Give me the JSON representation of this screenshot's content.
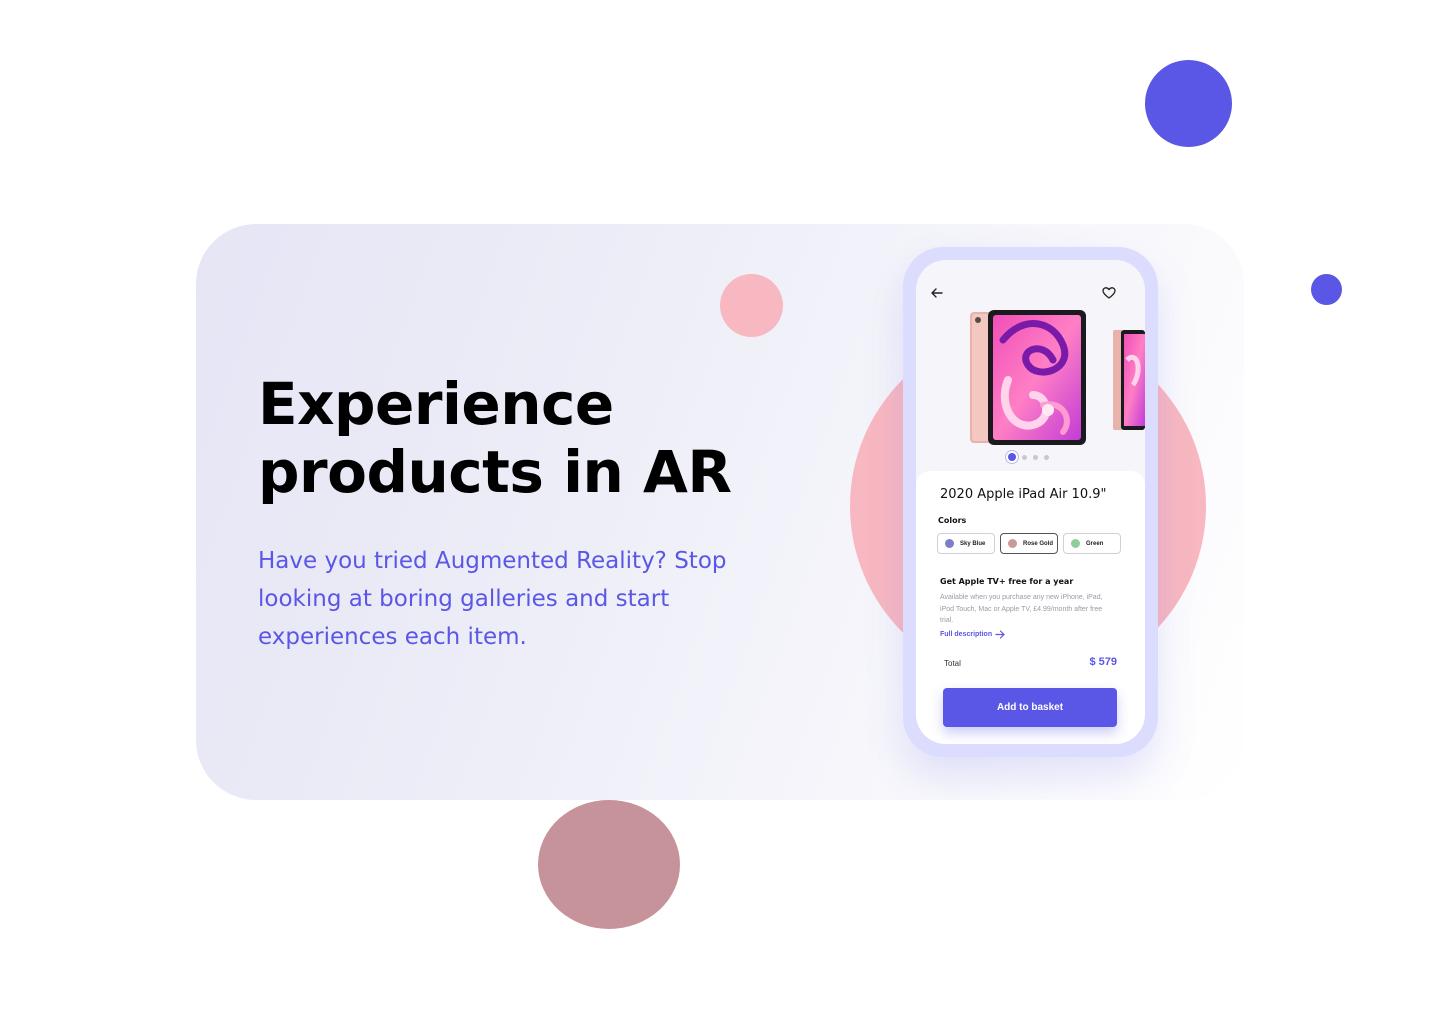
{
  "hero": {
    "headline_line1": "Experience",
    "headline_line2": "products in AR",
    "subtext": "Have you tried Augmented Reality? Stop looking at boring galleries and start experiences each item."
  },
  "app": {
    "product_title": "2020 Apple iPad Air 10.9\"",
    "gallery": {
      "dots": 4,
      "active_index": 0
    },
    "colors_label": "Colors",
    "colors": [
      {
        "label": "Sky Blue",
        "swatch": "#7a7fc6",
        "selected": false
      },
      {
        "label": "Rose Gold",
        "swatch": "#c99a99",
        "selected": true
      },
      {
        "label": "Green",
        "swatch": "#8ecf99",
        "selected": false
      }
    ],
    "promo_title": "Get Apple TV+ free for a year",
    "promo_body": "Available when you purchase any new iPhone, iPad, iPod Touch, Mac or Apple TV, £4.99/month after free trial.",
    "full_description": "Full description",
    "total_label": "Total",
    "total_value": "$ 579",
    "cta_label": "Add to basket",
    "icons": {
      "back": "arrow-left-icon",
      "favorite": "heart-icon",
      "link": "arrow-right-icon"
    }
  },
  "colors": {
    "accent": "#5a57e6",
    "pink": "#f8b8c1",
    "mauve": "#c6939a",
    "phone_frame": "#dcdcff"
  }
}
